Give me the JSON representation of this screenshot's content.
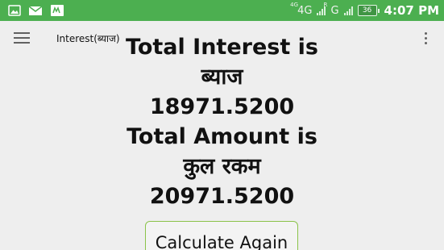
{
  "status_bar": {
    "icons_left": [
      "image-icon",
      "mail-icon",
      "app-icon"
    ],
    "network_1": "4G",
    "network_1_sup": "4G",
    "network_2": "G",
    "network_2_sup": "R",
    "battery": "36",
    "time": "4:07 PM",
    "colors": {
      "background": "#4caf50"
    }
  },
  "app_bar": {
    "title": "Interest(ब्याज)",
    "menu_icon": "menu-icon",
    "overflow_icon": "more-vert-icon"
  },
  "result": {
    "interest_label": "Total Interest is",
    "interest_label_hindi": "ब्याज",
    "interest_value": "18971.5200",
    "amount_label": "Total Amount is",
    "amount_label_hindi": "कुल रकम",
    "amount_value": "20971.5200"
  },
  "actions": {
    "calculate_again_label": "Calculate Again",
    "colors": {
      "border": "#8bc34a"
    }
  }
}
